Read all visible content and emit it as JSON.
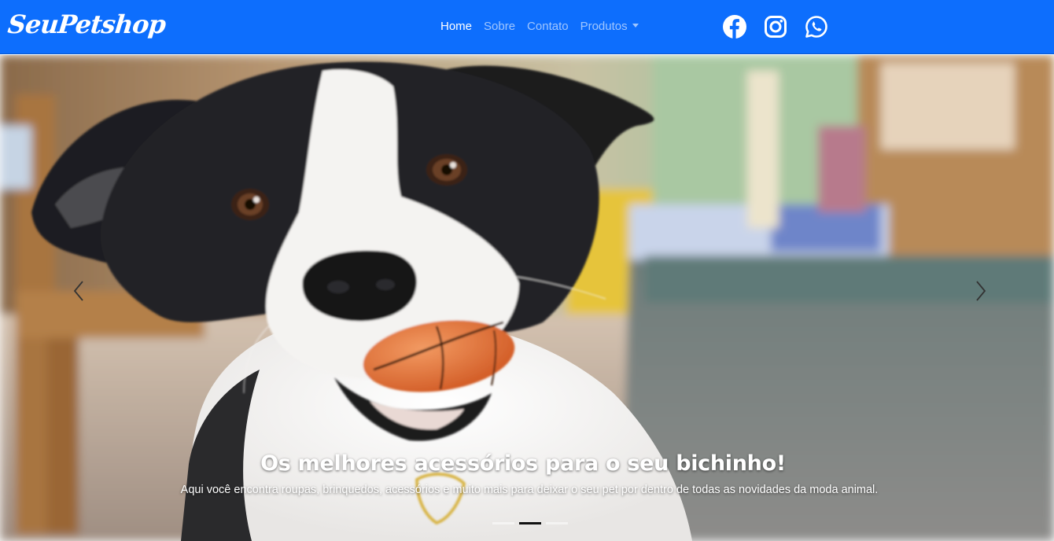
{
  "brand": {
    "name": "SeuPetshop"
  },
  "nav": {
    "items": [
      {
        "label": "Home",
        "active": true
      },
      {
        "label": "Sobre",
        "active": false
      },
      {
        "label": "Contato",
        "active": false
      },
      {
        "label": "Produtos",
        "active": false,
        "dropdown": true
      }
    ]
  },
  "social": {
    "icons": [
      "facebook-icon",
      "instagram-icon",
      "whatsapp-icon"
    ]
  },
  "carousel": {
    "caption_title": "Os melhores acessórios para o seu bichinho!",
    "caption_text": "Aqui você encontra roupas, brinquedos, acessórios e muito mais para deixar o seu pet por dentro de todas as novidades da moda animal.",
    "slide_count": 3,
    "active_index": 1,
    "controls": [
      "prev-arrow-icon",
      "next-arrow-icon"
    ]
  },
  "colors": {
    "navbar": "#0d6efd",
    "text": "#ffffff",
    "indicator_active": "#111111"
  }
}
